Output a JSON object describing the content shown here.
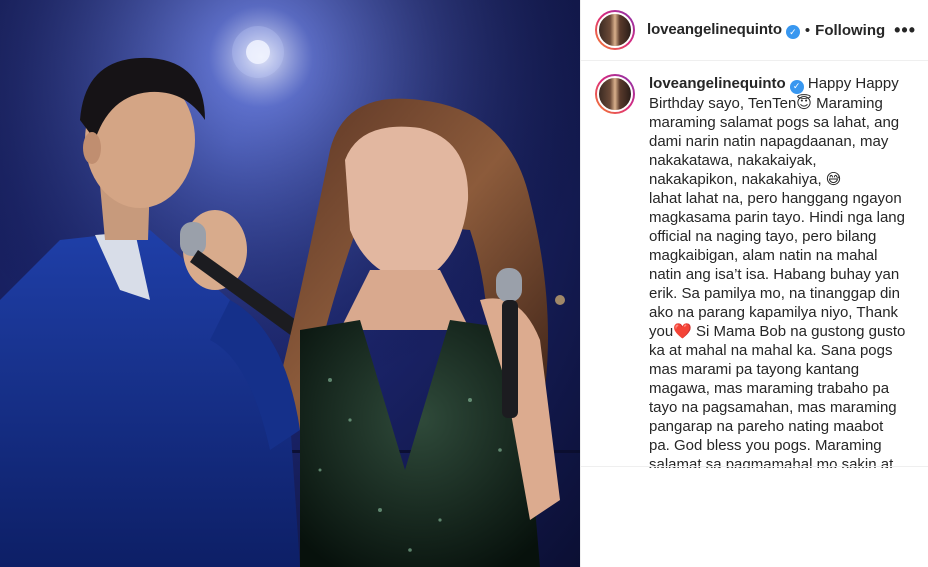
{
  "post": {
    "photo_alt": "Two singers performing on stage",
    "header": {
      "username": "loveangelinequinto",
      "verified_icon": "verified-badge-icon",
      "separator": "•",
      "follow_label": "Following",
      "more_label": "•••"
    },
    "caption": {
      "username": "loveangelinequinto",
      "paragraph1": "Happy Happy Birthday sayo, TenTen😇 Maraming maraming salamat pogs sa lahat, ang dami narin natin napagdaanan, may nakakatawa, nakakaiyak, nakakapikon, nakakahiya, 😅",
      "paragraph2_a": "lahat lahat na, pero hanggang ngayon magkasama parin tayo. Hindi nga lang official na naging tayo, pero bilang magkaibigan, alam natin na mahal natin ang isa’t isa. Habang buhay yan erik. Sa pamilya mo, na tinanggap din ako na parang kapamilya niyo, Thank you",
      "heart": "❤️",
      "paragraph2_b": " Si Mama Bob na gustong gusto ka at mahal na mahal ka. Sana pogs mas marami pa tayong kantang magawa, mas maraming trabaho pa tayo na pagsamahan, mas maraming pangarap na pareho nating maabot pa. God bless you pogs. Maraming salamat sa pagmamahal mo sakin at"
    }
  }
}
